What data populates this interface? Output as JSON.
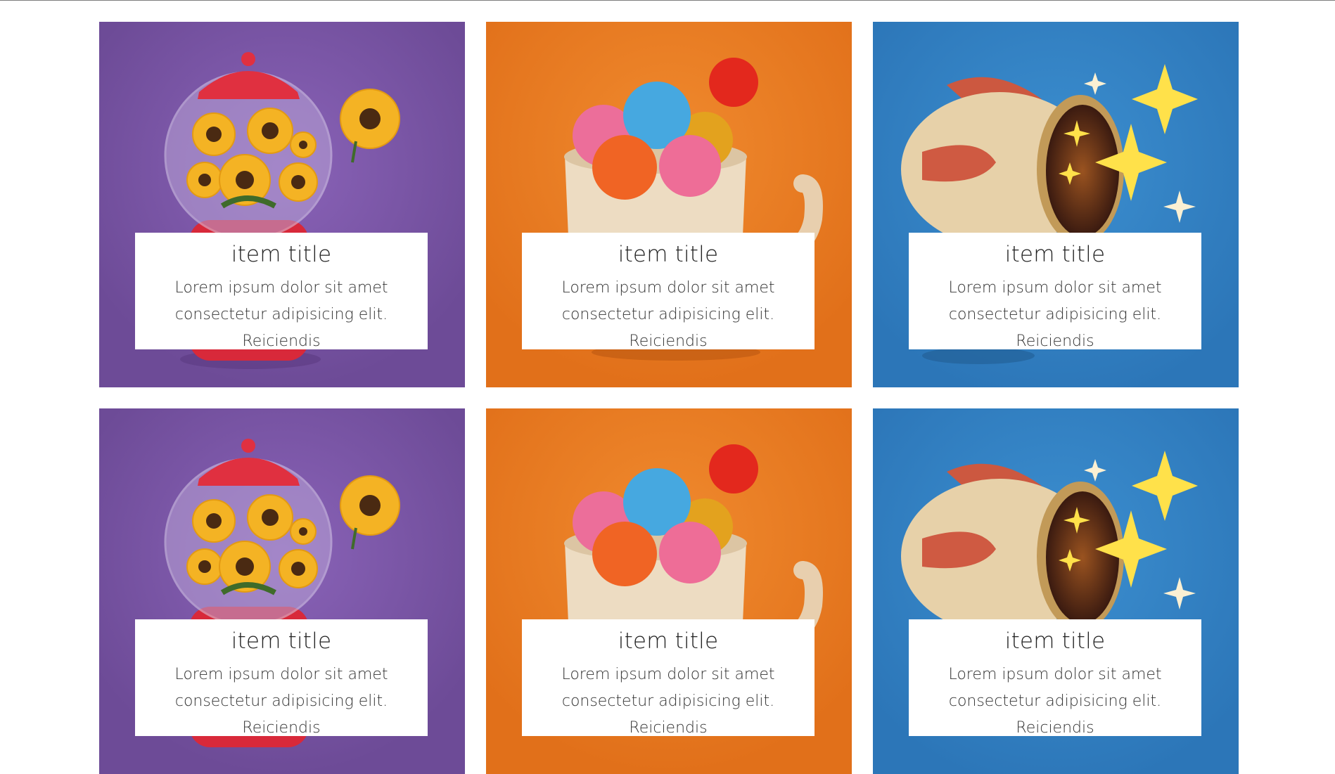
{
  "cards": [
    {
      "theme": "purple",
      "bg": "#7a55a6",
      "title": "item title",
      "text": "Lorem ipsum dolor sit amet consectetur adipisicing elit. Reiciendis"
    },
    {
      "theme": "orange",
      "bg": "#ea7b22",
      "title": "item title",
      "text": "Lorem ipsum dolor sit amet consectetur adipisicing elit. Reiciendis"
    },
    {
      "theme": "blue",
      "bg": "#3383c4",
      "title": "item title",
      "text": "Lorem ipsum dolor sit amet consectetur adipisicing elit. Reiciendis"
    },
    {
      "theme": "purple",
      "bg": "#7a55a6",
      "title": "item title",
      "text": "Lorem ipsum dolor sit amet consectetur adipisicing elit. Reiciendis"
    },
    {
      "theme": "orange",
      "bg": "#ea7b22",
      "title": "item title",
      "text": "Lorem ipsum dolor sit amet consectetur adipisicing elit. Reiciendis"
    },
    {
      "theme": "blue",
      "bg": "#3383c4",
      "title": "item title",
      "text": "Lorem ipsum dolor sit amet consectetur adipisicing elit. Reiciendis"
    }
  ],
  "icons": [
    "sunflower-gumball-machine-illustration",
    "candy-mug-illustration",
    "rocket-stars-illustration"
  ]
}
